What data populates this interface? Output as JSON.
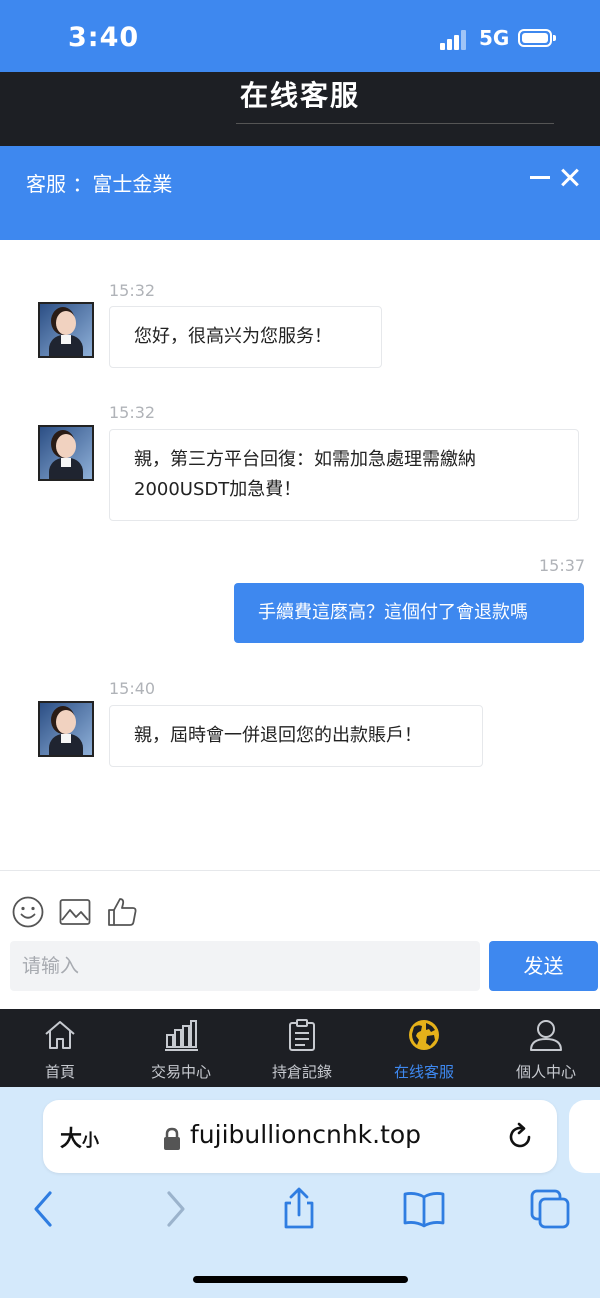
{
  "status": {
    "time": "3:40",
    "network": "5G"
  },
  "header": {
    "title": "在线客服"
  },
  "support": {
    "label": "客服 ：富士金業"
  },
  "messages": [
    {
      "time": "15:32",
      "text": "您好，很高兴为您服务！",
      "direction": "in"
    },
    {
      "time": "15:32",
      "text": "親，第三方平台回復：如需加急處理需繳納2000USDT加急費！",
      "direction": "in"
    },
    {
      "time": "15:37",
      "text": "手續費這麼高？這個付了會退款嗎",
      "direction": "out"
    },
    {
      "time": "15:40",
      "text": "親，屆時會一併退回您的出款賬戶！",
      "direction": "in"
    }
  ],
  "input": {
    "placeholder": "请输入",
    "send_label": "发送"
  },
  "tools": [
    "emoji-icon",
    "image-icon",
    "thumbs-up-icon"
  ],
  "nav": {
    "items": [
      {
        "label": "首頁",
        "icon": "home-icon",
        "active": false
      },
      {
        "label": "交易中心",
        "icon": "chart-icon",
        "active": false
      },
      {
        "label": "持倉記錄",
        "icon": "clipboard-icon",
        "active": false
      },
      {
        "label": "在线客服",
        "icon": "globe-icon",
        "active": true
      },
      {
        "label": "個人中心",
        "icon": "user-icon",
        "active": false
      }
    ]
  },
  "browser": {
    "aa_big": "大",
    "aa_small": "小",
    "url": "fujibullioncnhk.top"
  },
  "colors": {
    "accent": "#3e88ef",
    "dark": "#1d1f24",
    "browser_bg": "#d4e9fb"
  }
}
